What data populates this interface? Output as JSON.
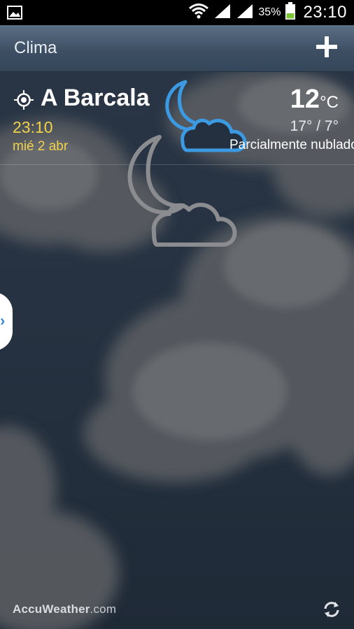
{
  "status_bar": {
    "battery_percent": "35%",
    "time": "23:10",
    "icons": [
      "image-notification-icon",
      "wifi-icon",
      "signal-icon",
      "signal-icon",
      "battery-icon"
    ]
  },
  "action_bar": {
    "title": "Clima",
    "add_icon": "plus-icon"
  },
  "city_card": {
    "city": "A Barcala",
    "local_time": "23:10",
    "date": "mié 2 abr",
    "temperature": "12",
    "unit": "°C",
    "hi_lo": "17° / 7°",
    "condition": "Parcialmente nublado",
    "location_icon": "location-target-icon",
    "weather_icon": "moon-cloud-icon"
  },
  "footer": {
    "brand_name": "AccuWeather",
    "brand_tld": ".com",
    "refresh_icon": "refresh-icon"
  },
  "colors": {
    "accent_yellow": "#f1d24a",
    "icon_blue": "#3b9ae1",
    "action_bar": "#4a5d73",
    "background": "#243040"
  }
}
